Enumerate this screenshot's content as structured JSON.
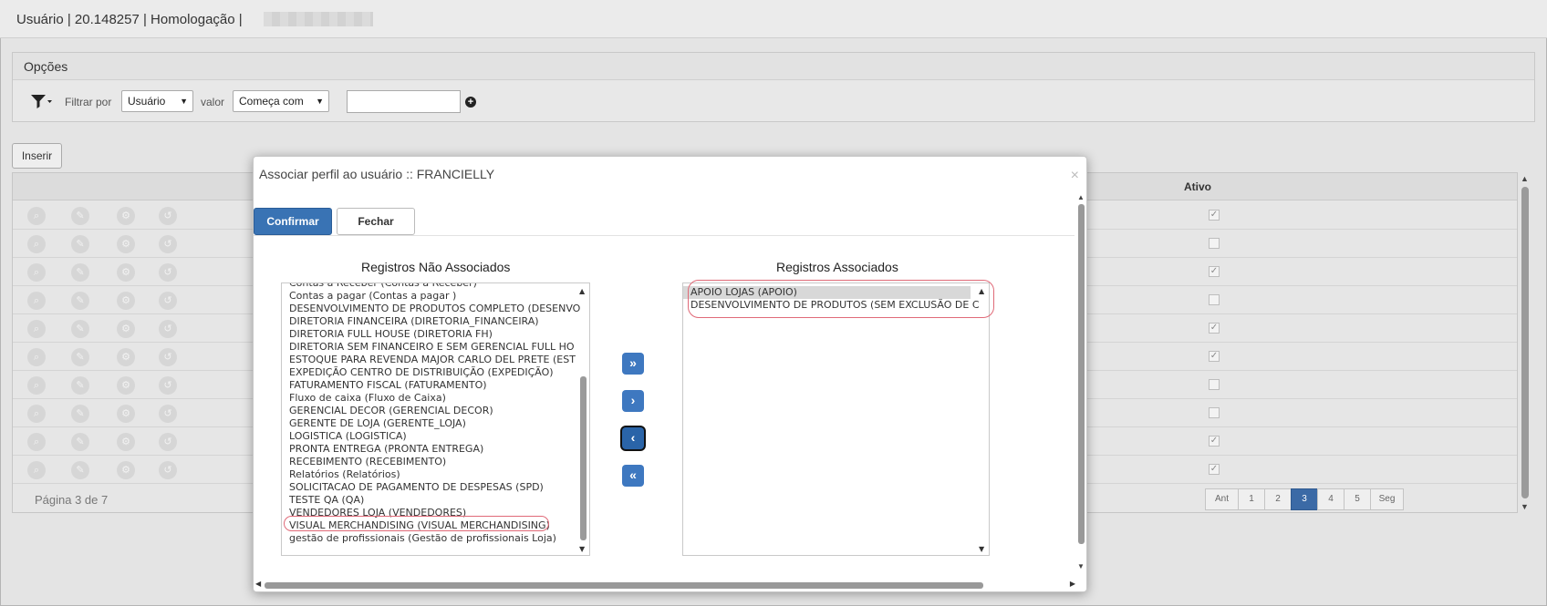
{
  "header": {
    "title": "Usuário | 20.148257 | Homologação |"
  },
  "opcoes": {
    "title": "Opções",
    "filter_label": "Filtrar por",
    "filter_by": "Usuário",
    "value_label": "valor",
    "operator": "Começa com",
    "value": ""
  },
  "toolbar": {
    "insert_label": "Inserir"
  },
  "grid": {
    "ativo_header": "Ativo",
    "rows_checked": [
      true,
      false,
      true,
      false,
      true,
      true,
      false,
      false,
      true,
      true
    ],
    "page_label": "Página 3 de 7",
    "pages": [
      "Ant",
      "1",
      "2",
      "3",
      "4",
      "5",
      "Seg"
    ],
    "current_page": "3"
  },
  "modal": {
    "title": "Associar perfil ao usuário :: FRANCIELLY",
    "confirm_label": "Confirmar",
    "close_label": "Fechar",
    "left_title": "Registros Não Associados",
    "right_title": "Registros Associados",
    "unassociated": [
      "Contas a Receber (Contas a Receber)",
      "Contas a pagar (Contas a pagar )",
      "DESENVOLVIMENTO DE PRODUTOS COMPLETO (DESENVO",
      "DIRETORIA FINANCEIRA (DIRETORIA_FINANCEIRA)",
      "DIRETORIA FULL HOUSE (DIRETORIA FH)",
      "DIRETORIA SEM FINANCEIRO E SEM GERENCIAL FULL HO",
      "ESTOQUE PARA REVENDA MAJOR CARLO DEL PRETE (EST",
      "EXPEDIÇÃO CENTRO DE DISTRIBUIÇÃO (EXPEDIÇÃO)",
      "FATURAMENTO FISCAL (FATURAMENTO)",
      "Fluxo de caixa (Fluxo de Caixa)",
      "GERENCIAL DECOR (GERENCIAL DECOR)",
      "GERENTE DE LOJA (GERENTE_LOJA)",
      "LOGISTICA (LOGISTICA)",
      "PRONTA ENTREGA (PRONTA ENTREGA)",
      "RECEBIMENTO (RECEBIMENTO)",
      "Relatórios (Relatórios)",
      "SOLICITACAO DE PAGAMENTO DE DESPESAS (SPD)",
      "TESTE QA (QA)",
      "VENDEDORES LOJA (VENDEDORES)",
      "VISUAL MERCHANDISING (VISUAL MERCHANDISING)",
      "gestão de profissionais (Gestão de profissionais Loja)"
    ],
    "associated": [
      "APOIO LOJAS (APOIO)",
      "DESENVOLVIMENTO DE PRODUTOS (SEM EXCLUSÃO DE C"
    ],
    "transfer_icons": [
      "move-all-right-icon",
      "move-right-icon",
      "move-left-icon",
      "move-all-left-icon"
    ]
  },
  "colors": {
    "primary": "#3973b4",
    "highlight": "#e06a78"
  }
}
